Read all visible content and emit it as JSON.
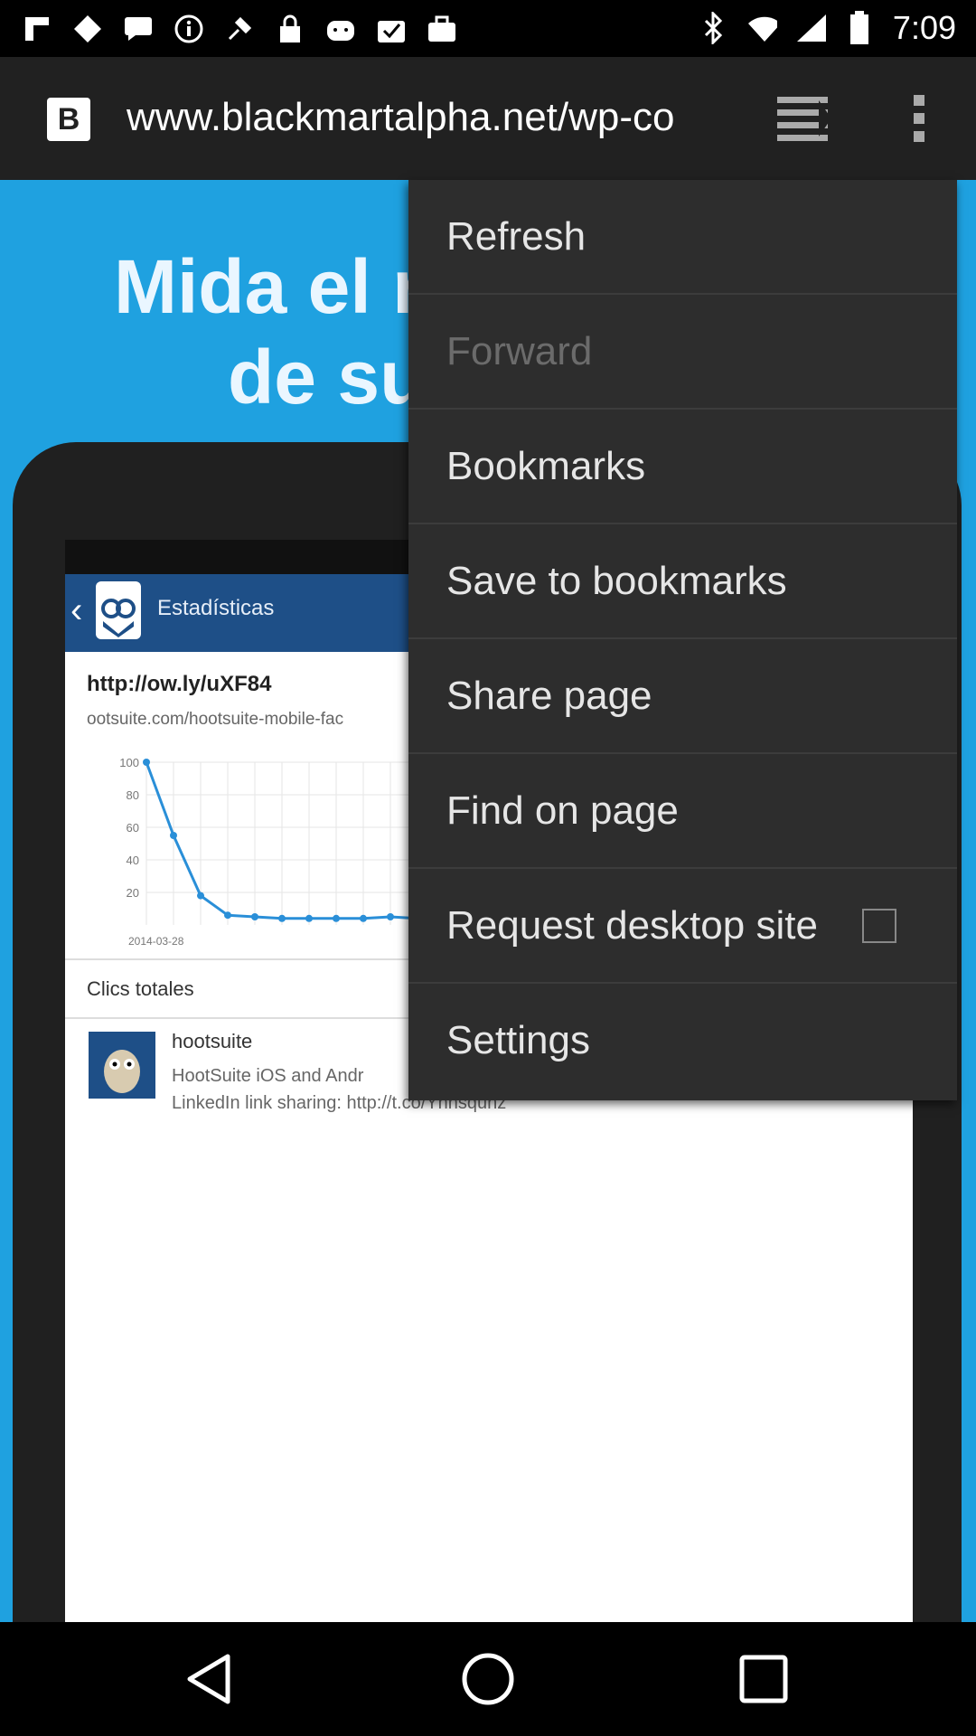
{
  "status_bar": {
    "time": "7:09",
    "left_icons": [
      "flipboard-icon",
      "diamond-icon",
      "message-icon",
      "info-icon",
      "satellite-icon",
      "lock-icon",
      "toast-icon",
      "checklist-icon",
      "briefcase-icon"
    ],
    "right_icons": [
      "bluetooth-icon",
      "wifi-icon",
      "signal-icon",
      "battery-icon"
    ]
  },
  "browser": {
    "url": "www.blackmartalpha.net/wp-co",
    "favicon_letter": "B"
  },
  "page": {
    "headline_line1": "Mida el r",
    "headline_line2": "de su",
    "app_title": "Estadísticas",
    "link_title": "http://ow.ly/uXF84",
    "link_sub": "ootsuite.com/hootsuite-mobile-fac",
    "chart_ticks": [
      "100",
      "80",
      "60",
      "40",
      "20"
    ],
    "chart_date": "2014-03-28",
    "clics_label": "Clics totales",
    "hs_name": "hootsuite",
    "hs_line1": "HootSuite iOS and Andr",
    "hs_line2": "LinkedIn link sharing: http://t.co/Yhhsqunz"
  },
  "chart_data": {
    "type": "line",
    "x": [
      "2014-03-28",
      "",
      "",
      "",
      "",
      "",
      "",
      "",
      "",
      "",
      ""
    ],
    "y": [
      100,
      55,
      18,
      6,
      5,
      4,
      4,
      4,
      4,
      5,
      4
    ],
    "ylim": [
      0,
      100
    ],
    "yticks": [
      "100",
      "80",
      "60",
      "40",
      "20"
    ]
  },
  "menu": {
    "items": [
      {
        "label": "Refresh",
        "enabled": true
      },
      {
        "label": "Forward",
        "enabled": false
      },
      {
        "label": "Bookmarks",
        "enabled": true
      },
      {
        "label": "Save to bookmarks",
        "enabled": true
      },
      {
        "label": "Share page",
        "enabled": true
      },
      {
        "label": "Find on page",
        "enabled": true
      },
      {
        "label": "Request desktop site",
        "enabled": true,
        "checked": false
      },
      {
        "label": "Settings",
        "enabled": true
      }
    ]
  },
  "nav_bar": {
    "buttons": [
      "back-icon",
      "home-icon",
      "recents-icon"
    ]
  },
  "colors": {
    "page_blue": "#1fa1e0",
    "menu_bg": "#2d2d2d",
    "urlbar_bg": "#212121"
  }
}
